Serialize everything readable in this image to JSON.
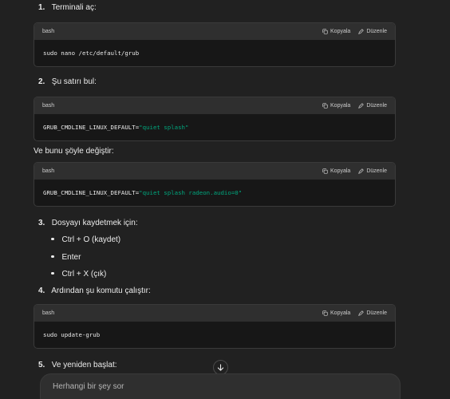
{
  "steps": [
    {
      "num": "1.",
      "text": "Terminali aç:"
    },
    {
      "num": "2.",
      "text": "Şu satırı bul:"
    },
    {
      "num": "3.",
      "text": "Dosyayı kaydetmek için:"
    },
    {
      "num": "4.",
      "text": "Ardından şu komutu çalıştır:"
    },
    {
      "num": "5.",
      "text": "Ve yeniden başlat:"
    }
  ],
  "replace_text": "Ve bunu şöyle değiştir:",
  "code_blocks": [
    {
      "lang": "bash",
      "copy_label": "Kopyala",
      "edit_label": "Düzenle",
      "code": "sudo nano /etc/default/grub",
      "code_prefix": "",
      "code_string": ""
    },
    {
      "lang": "bash",
      "copy_label": "Kopyala",
      "edit_label": "Düzenle",
      "code": "",
      "code_prefix": "GRUB_CMDLINE_LINUX_DEFAULT=",
      "code_string": "\"quiet splash\""
    },
    {
      "lang": "bash",
      "copy_label": "Kopyala",
      "edit_label": "Düzenle",
      "code": "",
      "code_prefix": "GRUB_CMDLINE_LINUX_DEFAULT=",
      "code_string": "\"quiet splash radeon.audio=0\""
    },
    {
      "lang": "bash",
      "copy_label": "Kopyala",
      "edit_label": "Düzenle",
      "code": "sudo update-grub",
      "code_prefix": "",
      "code_string": ""
    }
  ],
  "bullets": [
    "Ctrl + O (kaydet)",
    "Enter",
    "Ctrl + X (çık)"
  ],
  "composer": {
    "placeholder": "Herhangi bir şey sor"
  },
  "colors": {
    "background": "#212121",
    "code_bg": "#171717",
    "code_header": "#2f2f2f",
    "string": "#00a67d"
  }
}
